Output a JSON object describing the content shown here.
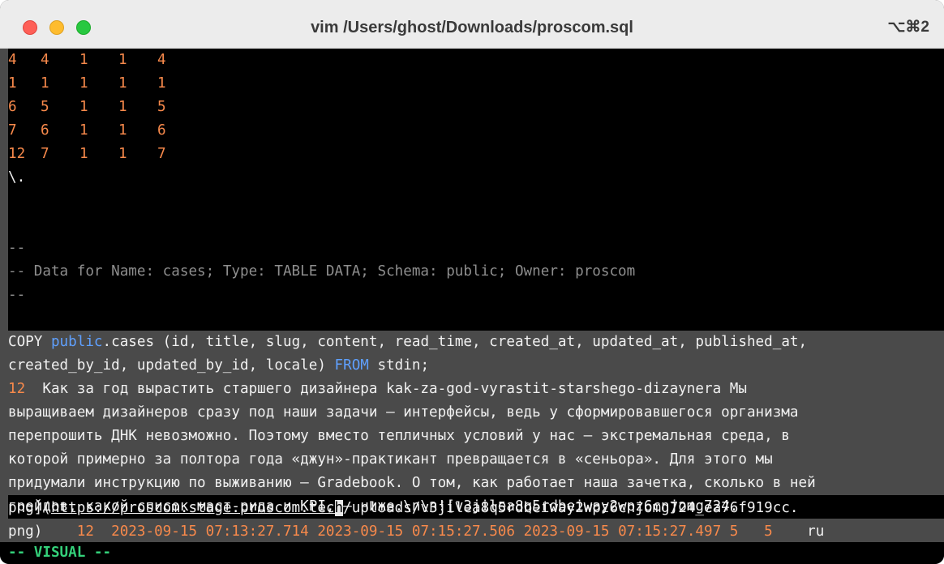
{
  "window": {
    "title": "vim /Users/ghost/Downloads/proscom.sql",
    "shortcut": "⌥⌘2"
  },
  "table_rows": [
    [
      "4",
      "4",
      "1",
      "1",
      "4"
    ],
    [
      "1",
      "1",
      "1",
      "1",
      "1"
    ],
    [
      "6",
      "5",
      "1",
      "1",
      "5"
    ],
    [
      "7",
      "6",
      "1",
      "1",
      "6"
    ],
    [
      "12",
      "7",
      "1",
      "1",
      "7"
    ]
  ],
  "end_marker": "\\.",
  "comment": {
    "dash": "--",
    "prefix": "-- ",
    "text": "Data for Name: cases; Type: TABLE DATA; Schema: public; Owner: proscom"
  },
  "copy": {
    "keyword_copy": "COPY ",
    "schema": "public",
    "rest1": ".cases (id, title, slug, content, read_time, created_at, updated_at, published_at,",
    "rest2": "created_by_id, updated_by_id, locale) ",
    "keyword_from": "FROM",
    "rest3": " stdin;"
  },
  "record": {
    "id": "12",
    "line1": "  Как за год вырастить старшего дизайнера kak-za-god-vyrastit-starshego-dizaynera Мы",
    "line2": "выращиваем дизайнеров сразу под наши задачи — интерфейсы, ведь у сформировавшегося организма",
    "line3": "перепрошить ДНК невозможно. Поэтому вместо тепличных условий у нас — экстремальная среда, в",
    "line4": "которой примерно за полтора года «джун»-практикант превращается в «сеньора». Для этого мы",
    "line5": "придумали инструкцию по выживанию — Gradebook. О том, как работает наша зачетка, сколько в ней",
    "line6": "грейдов, какой список маст-рида и KPI, — ниже.\\n\\n![v3jilea8q5rdbeiway2wpz6cnjomg724.",
    "line7_pre": "png](",
    "line7_url_a": "https://proscom.stage.proscom.tec",
    "line7_cursor": "h",
    "line7_post": "/uploads/v3jilea8q5rdbeiway2wpz6cnjomg724_ea76f919cc.",
    "line8_pre": "png)",
    "read_time": "12",
    "created_at": "2023-09-15 07:13:27.714",
    "updated_at": "2023-09-15 07:15:27.506",
    "published_at": "2023-09-15 07:15:27.497",
    "created_by_id": "5",
    "updated_by_id": "5",
    "locale": "ru"
  },
  "mode": "-- VISUAL --",
  "colors": {
    "number": "#f7894b",
    "comment": "#8e8e8e",
    "keyword": "#5fa0ff",
    "visual_mode": "#34d17a",
    "selection": "#4a4a4a"
  }
}
